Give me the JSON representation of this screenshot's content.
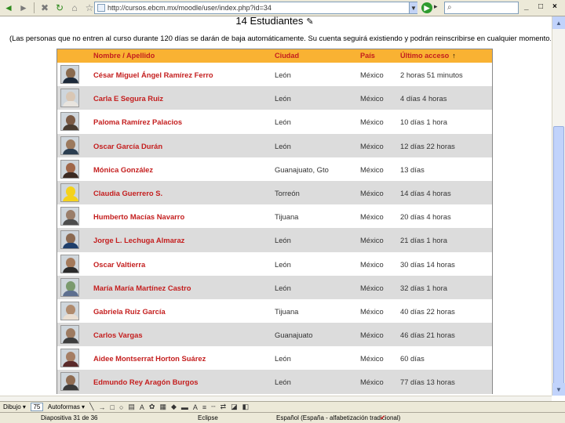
{
  "browser": {
    "back_label": "◄",
    "forward_label": "►",
    "address": "http://cursos.ebcm.mx/moodle/user/index.php?id=34",
    "go_label": "▶",
    "title_icons": [
      "back-icon",
      "forward-icon",
      "stop-icon",
      "refresh-icon",
      "home-icon",
      "search-icon"
    ]
  },
  "page": {
    "heading": "14 Estudiantes",
    "notice": "(Las personas que no entren al curso durante 120 días se darán de baja automáticamente. Su cuenta seguirá existiendo y podrán reinscribirse en cualquier momento.)"
  },
  "table": {
    "columns": {
      "name": "Nombre / Apellido",
      "city": "Ciudad",
      "country": "País",
      "access": "Último acceso"
    },
    "rows": [
      {
        "name": "César Miguel Ángel Ramírez Ferro",
        "city": "León",
        "country": "México",
        "access": "2 horas 51 minutos"
      },
      {
        "name": "Carla E Segura Ruiz",
        "city": "León",
        "country": "México",
        "access": "4 días 4 horas"
      },
      {
        "name": "Paloma Ramírez Palacios",
        "city": "León",
        "country": "México",
        "access": "10 días 1 hora"
      },
      {
        "name": "Oscar García Durán",
        "city": "León",
        "country": "México",
        "access": "12 días 22 horas"
      },
      {
        "name": "Mónica González",
        "city": "Guanajuato, Gto",
        "country": "México",
        "access": "13 días"
      },
      {
        "name": "Claudia Guerrero S.",
        "city": "Torreón",
        "country": "México",
        "access": "14 días 4 horas"
      },
      {
        "name": "Humberto Macías Navarro",
        "city": "Tijuana",
        "country": "México",
        "access": "20 días 4 horas"
      },
      {
        "name": "Jorge L. Lechuga Almaraz",
        "city": "León",
        "country": "México",
        "access": "21 días 1 hora"
      },
      {
        "name": "Oscar Valtierra",
        "city": "León",
        "country": "México",
        "access": "30 días 14 horas"
      },
      {
        "name": "María María Martínez Castro",
        "city": "León",
        "country": "México",
        "access": "32 días 1 hora"
      },
      {
        "name": "Gabriela Ruiz García",
        "city": "Tijuana",
        "country": "México",
        "access": "40 días 22 horas"
      },
      {
        "name": "Carlos Vargas",
        "city": "Guanajuato",
        "country": "México",
        "access": "46 días 21 horas"
      },
      {
        "name": "Aidee Montserrat Horton Suárez",
        "city": "León",
        "country": "México",
        "access": "60 días"
      },
      {
        "name": "Edmundo Rey Aragón Burgos",
        "city": "León",
        "country": "México",
        "access": "77 días 13 horas"
      }
    ]
  },
  "app": {
    "draw_label": "Dibujo ▾",
    "zoom": "75",
    "autoshapes_label": "Autoformas ▾"
  },
  "status": {
    "slide": "Diapositiva 31 de 36",
    "design": "Eclipse",
    "language": "Español (España - alfabetización tradicional)"
  },
  "colors": {
    "header_bg": "#f9b233",
    "name_color": "#c41e1e",
    "row_alt": "#dcdcdc"
  }
}
